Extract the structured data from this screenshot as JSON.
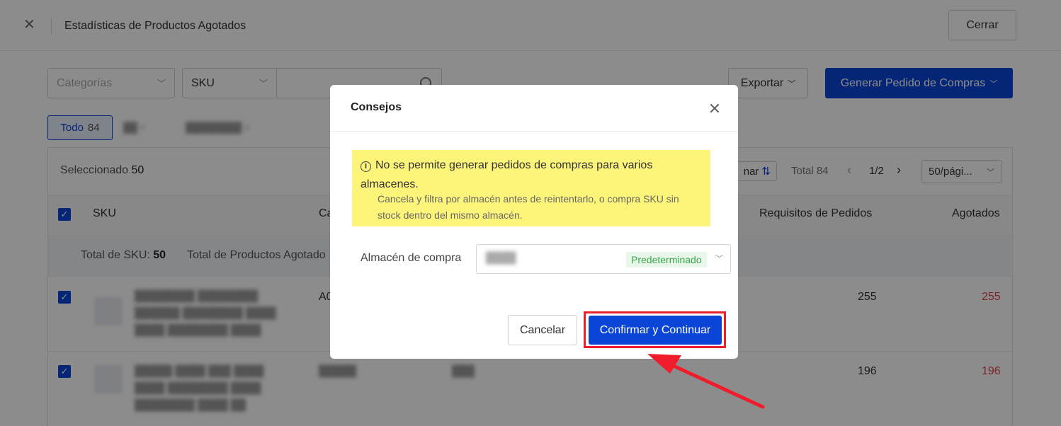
{
  "header": {
    "title": "Estadísticas de Productos Agotados",
    "close_label": "Cerrar"
  },
  "filters": {
    "category_placeholder": "Categorías",
    "search_field": "SKU",
    "export_label": "Exportar",
    "generate_label": "Generar Pedido de Compras"
  },
  "tabs": {
    "all_label": "Todo",
    "all_count": "84"
  },
  "table": {
    "selected_label": "Seleccionado",
    "selected_count": "50",
    "sort_label": "nar",
    "total_label": "Total 84",
    "page": "1/2",
    "per_page": "50/pági...",
    "columns": {
      "sku": "SKU",
      "cat": "Ca",
      "requirements": "Requisitos de Pedidos",
      "out_of_stock": "Agotados"
    },
    "summary": {
      "total_sku_label": "Total de SKU:",
      "total_sku_value": "50",
      "total_out_label": "Total de Productos Agotado"
    },
    "rows": [
      {
        "col2": "A0",
        "requirements": "255",
        "out": "255"
      },
      {
        "col2": "",
        "requirements": "196",
        "out": "196"
      }
    ]
  },
  "modal": {
    "title": "Consejos",
    "tip_main": "No se permite generar pedidos de compras para varios almacenes.",
    "tip_sub": "Cancela y filtra por almacén antes de reintentarlo, o compra SKU sin stock dentro del mismo almacén.",
    "warehouse_label": "Almacén de compra",
    "warehouse_badge": "Predeterminado",
    "cancel_label": "Cancelar",
    "confirm_label": "Confirmar y Continuar"
  },
  "colors": {
    "primary": "#0a45d8",
    "highlight": "#e8202a",
    "tip_bg": "#fdf47a",
    "badge_green": "#3aa54a",
    "out_red": "#e0424d"
  }
}
